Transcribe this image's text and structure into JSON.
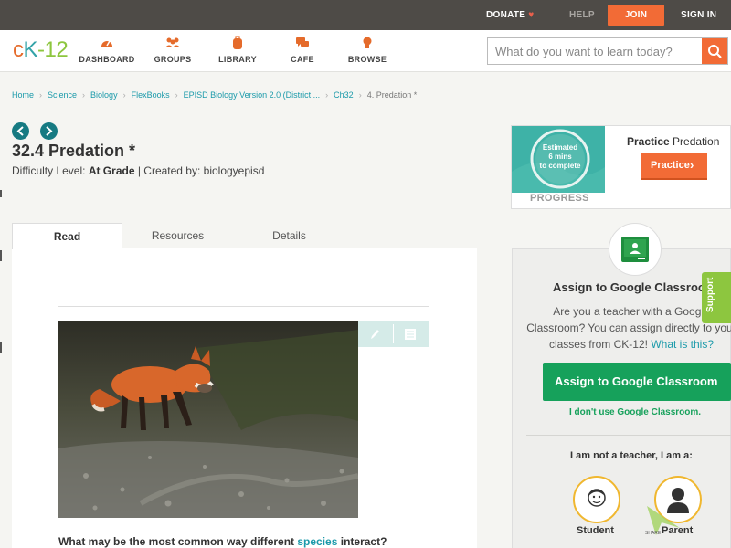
{
  "topbar": {
    "donate": "DONATE",
    "help": "HELP",
    "join": "JOIN",
    "signin": "SIGN IN"
  },
  "logo": {
    "c": "c",
    "k": "K",
    "dash": "-",
    "num": "12"
  },
  "nav": [
    {
      "label": "DASHBOARD",
      "icon": "dashboard-gauge-icon"
    },
    {
      "label": "GROUPS",
      "icon": "groups-people-icon"
    },
    {
      "label": "LIBRARY",
      "icon": "library-backpack-icon"
    },
    {
      "label": "CAFE",
      "icon": "cafe-chat-icon"
    },
    {
      "label": "BROWSE",
      "icon": "browse-bulb-icon"
    }
  ],
  "search": {
    "placeholder": "What do you want to learn today?"
  },
  "breadcrumb": {
    "items": [
      "Home",
      "Science",
      "Biology",
      "FlexBooks",
      "EPISD Biology Version 2.0 (District ...",
      "Ch32"
    ],
    "current": "4. Predation *"
  },
  "page": {
    "title": "32.4 Predation *",
    "difficulty_prefix": "Difficulty Level: ",
    "difficulty": "At Grade",
    "created_by": " | Created by: biologyepisd"
  },
  "tabs": [
    "Read",
    "Resources",
    "Details"
  ],
  "question": {
    "before": "What may be the most common way different ",
    "highlight": "species",
    "after": " interact?"
  },
  "practice": {
    "estimate_line1": "Estimated",
    "estimate_line2": "6 mins",
    "estimate_line3": "to complete",
    "progress_label": "PROGRESS",
    "title_bold": "Practice",
    "title_rest": " Predation",
    "button": "Practice"
  },
  "assign": {
    "title": "Assign to Google Classroom",
    "desc_part1": "Are you a teacher with a Google Classroom? You can assign directly to your classes from CK-12! ",
    "desc_link": "What is this?",
    "button": "Assign to Google Classroom",
    "no_classroom": "I don't use Google Classroom.",
    "not_teacher": "I am not a teacher, I am a:",
    "roles": [
      "Student",
      "Parent"
    ]
  },
  "support": "Support",
  "share_label": "SHARE",
  "colors": {
    "accent_orange": "#f26b36",
    "teal": "#1b9aaa",
    "green": "#16a15b",
    "topbar": "#4e4b47"
  }
}
